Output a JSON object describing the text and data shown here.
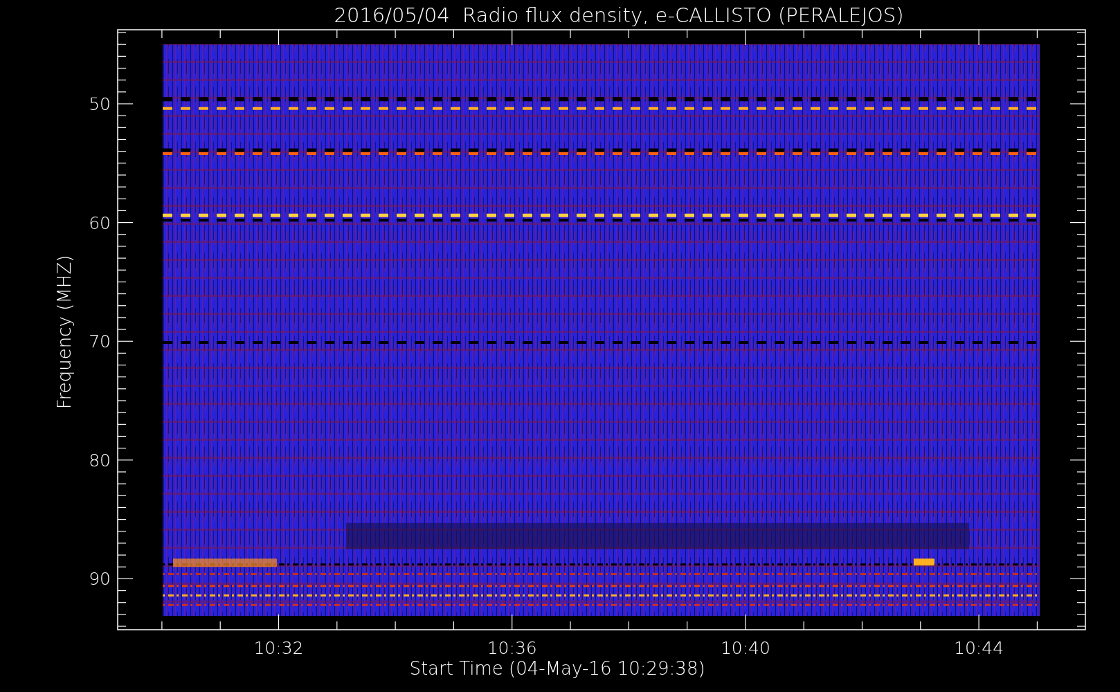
{
  "plot": {
    "title": "2016/05/04  Radio flux density, e-CALLISTO (PERALEJOS)",
    "xlabel": "Start Time (04-May-16 10:29:38)",
    "ylabel": "Frequency (MHZ)",
    "xtick_labels": [
      "10:32",
      "10:36",
      "10:40",
      "10:44"
    ],
    "ytick_labels": [
      "50",
      "60",
      "70",
      "80",
      "90"
    ]
  }
}
